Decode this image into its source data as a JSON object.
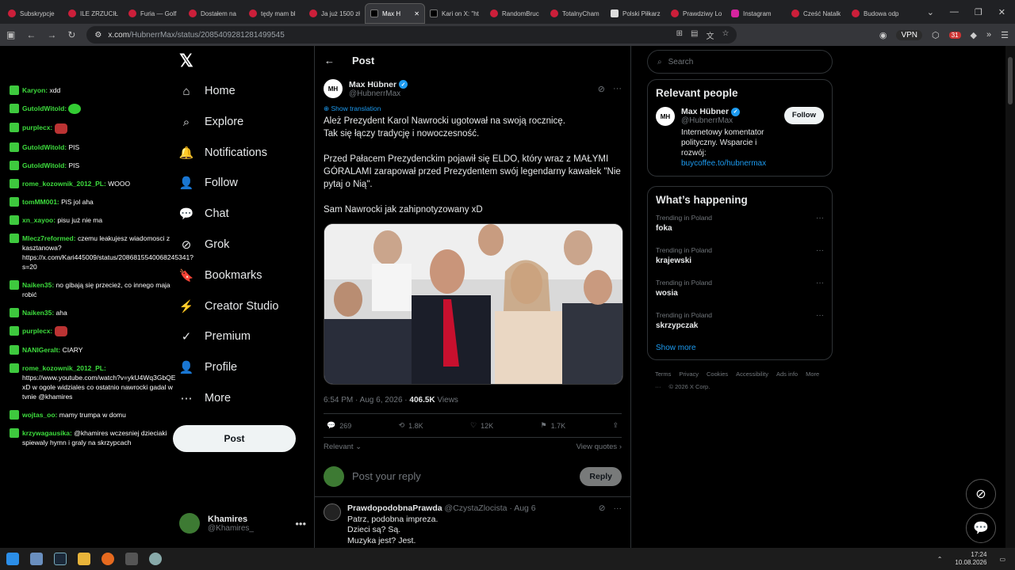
{
  "browser": {
    "tabs": [
      {
        "label": "Subskrypcje",
        "fav": "yt"
      },
      {
        "label": "ILE ZRZUCIŁ",
        "fav": "yt"
      },
      {
        "label": "Furia — Golf",
        "fav": "yt"
      },
      {
        "label": "Dostałem na",
        "fav": "yt"
      },
      {
        "label": "tędy mam bl",
        "fav": "yt"
      },
      {
        "label": "Ja już 1500 zł",
        "fav": "yt"
      },
      {
        "label": "Max H",
        "fav": "x",
        "active": true
      },
      {
        "label": "Kari on X: \"ht",
        "fav": "x"
      },
      {
        "label": "RandomBruc",
        "fav": "yt"
      },
      {
        "label": "TotalnyCham",
        "fav": "yt"
      },
      {
        "label": "Polski Piłkarz",
        "fav": "pl"
      },
      {
        "label": "Prawdziwy Lo",
        "fav": "yt"
      },
      {
        "label": "Instagram",
        "fav": "ig"
      },
      {
        "label": "Cześć Natalk",
        "fav": "yt"
      },
      {
        "label": "Budowa odp",
        "fav": "yt"
      }
    ],
    "url_host": "x.com",
    "url_path": "/HubnerrMax/status/2085409281281499545",
    "vpn_label": "VPN",
    "ext_badge": "31"
  },
  "chat": [
    {
      "user": "Karyon:",
      "msg": "xdd"
    },
    {
      "user": "GutoldWitold:",
      "msg": "",
      "emote": "green"
    },
    {
      "user": "purplecx:",
      "msg": "",
      "emote": "red"
    },
    {
      "user": "GutoldWitold:",
      "msg": "PIS"
    },
    {
      "user": "GutoldWitold:",
      "msg": "PIS"
    },
    {
      "user": "rome_kozownik_2012_PL:",
      "msg": "WOOO"
    },
    {
      "user": "tomMM001:",
      "msg": "PiS jol aha"
    },
    {
      "user": "xn_xayoo:",
      "msg": "pisu już nie ma"
    },
    {
      "user": "Mlecz7reformed:",
      "msg": "czemu leakujesz wiadomosci z kasztanowa? https://x.com/Kari445009/status/2086815540068245341?s=20"
    },
    {
      "user": "Naiken35:",
      "msg": "no gibają się przecież, co innego maja robić"
    },
    {
      "user": "Naiken35:",
      "msg": "aha"
    },
    {
      "user": "purplecx:",
      "msg": "",
      "emote": "red"
    },
    {
      "user": "NANIGeralt:",
      "msg": "CIARY"
    },
    {
      "user": "rome_kozownik_2012_PL:",
      "msg": "https://www.youtube.com/watch?v=ykU4Wq3GbQE xD w ogole widziales co ostatnio nawrocki gadal w tvnie @khamires"
    },
    {
      "user": "wojtas_oo:",
      "msg": "mamy trumpa w domu"
    },
    {
      "user": "krzywagausika:",
      "msg": "@khamires wczesniej dzieciaki spiewaly hymn i graly na skrzypcach"
    }
  ],
  "nav": {
    "items": [
      {
        "label": "Home",
        "icon": "⌂"
      },
      {
        "label": "Explore",
        "icon": "⌕"
      },
      {
        "label": "Notifications",
        "icon": "🔔"
      },
      {
        "label": "Follow",
        "icon": "👤"
      },
      {
        "label": "Chat",
        "icon": "💬"
      },
      {
        "label": "Grok",
        "icon": "⊘"
      },
      {
        "label": "Bookmarks",
        "icon": "🔖"
      },
      {
        "label": "Creator Studio",
        "icon": "⚡"
      },
      {
        "label": "Premium",
        "icon": "✓"
      },
      {
        "label": "Profile",
        "icon": "👤"
      },
      {
        "label": "More",
        "icon": "⋯"
      }
    ],
    "post_button": "Post",
    "account": {
      "name": "Khamires",
      "handle": "@Khamires_"
    }
  },
  "post": {
    "header": "Post",
    "author_name": "Max Hübner",
    "author_handle": "@HubnerrMax",
    "avatar_text": "MH",
    "show_translation": "Show translation",
    "body": "Ależ Prezydent Karol Nawrocki ugotował na swoją rocznicę.\nTak się łączy tradycję i nowoczesność.\n\nPrzed Pałacem Prezydenckim pojawił się ELDO, który wraz z MAŁYMI GÓRALAMI zarapował przed Prezydentem swój legendarny kawałek \"Nie pytaj o Nią\".\n\nSam Nawrocki jak zahipnotyzowany xD",
    "time": "6:54 PM · Aug 6, 2026 · ",
    "views_count": "406.5K",
    "views_label": " Views",
    "replies": "269",
    "reposts": "1.8K",
    "likes": "12K",
    "bookmarks": "1.7K",
    "sort_label": "Relevant",
    "view_quotes": "View quotes",
    "reply_placeholder": "Post your reply",
    "reply_button": "Reply"
  },
  "comment": {
    "name": "PrawdopodobnaPrawda",
    "handle": "@CzystaZlocista · Aug 6",
    "lines": [
      "Patrz, podobna impreza.",
      "Dzieci są? Są.",
      "Muzyka jest? Jest."
    ]
  },
  "sidebar": {
    "search_placeholder": "Search",
    "relevant_title": "Relevant people",
    "person": {
      "name": "Max Hübner",
      "handle": "@HubnerrMax",
      "bio": "Internetowy komentator polityczny. Wsparcie i rozwój: ",
      "link": "buycoffee.to/hubnermax",
      "follow": "Follow"
    },
    "happening_title": "What’s happening",
    "trends": [
      {
        "context": "Trending in Poland",
        "name": "foka"
      },
      {
        "context": "Trending in Poland",
        "name": "krajewski"
      },
      {
        "context": "Trending in Poland",
        "name": "wosia"
      },
      {
        "context": "Trending in Poland",
        "name": "skrzypczak"
      }
    ],
    "show_more": "Show more",
    "footer": [
      "Terms",
      "Privacy",
      "Cookies",
      "Accessibility",
      "Ads info",
      "More ···",
      "© 2026 X Corp."
    ]
  },
  "taskbar": {
    "time": "17:24",
    "date": "10.08.2026"
  }
}
